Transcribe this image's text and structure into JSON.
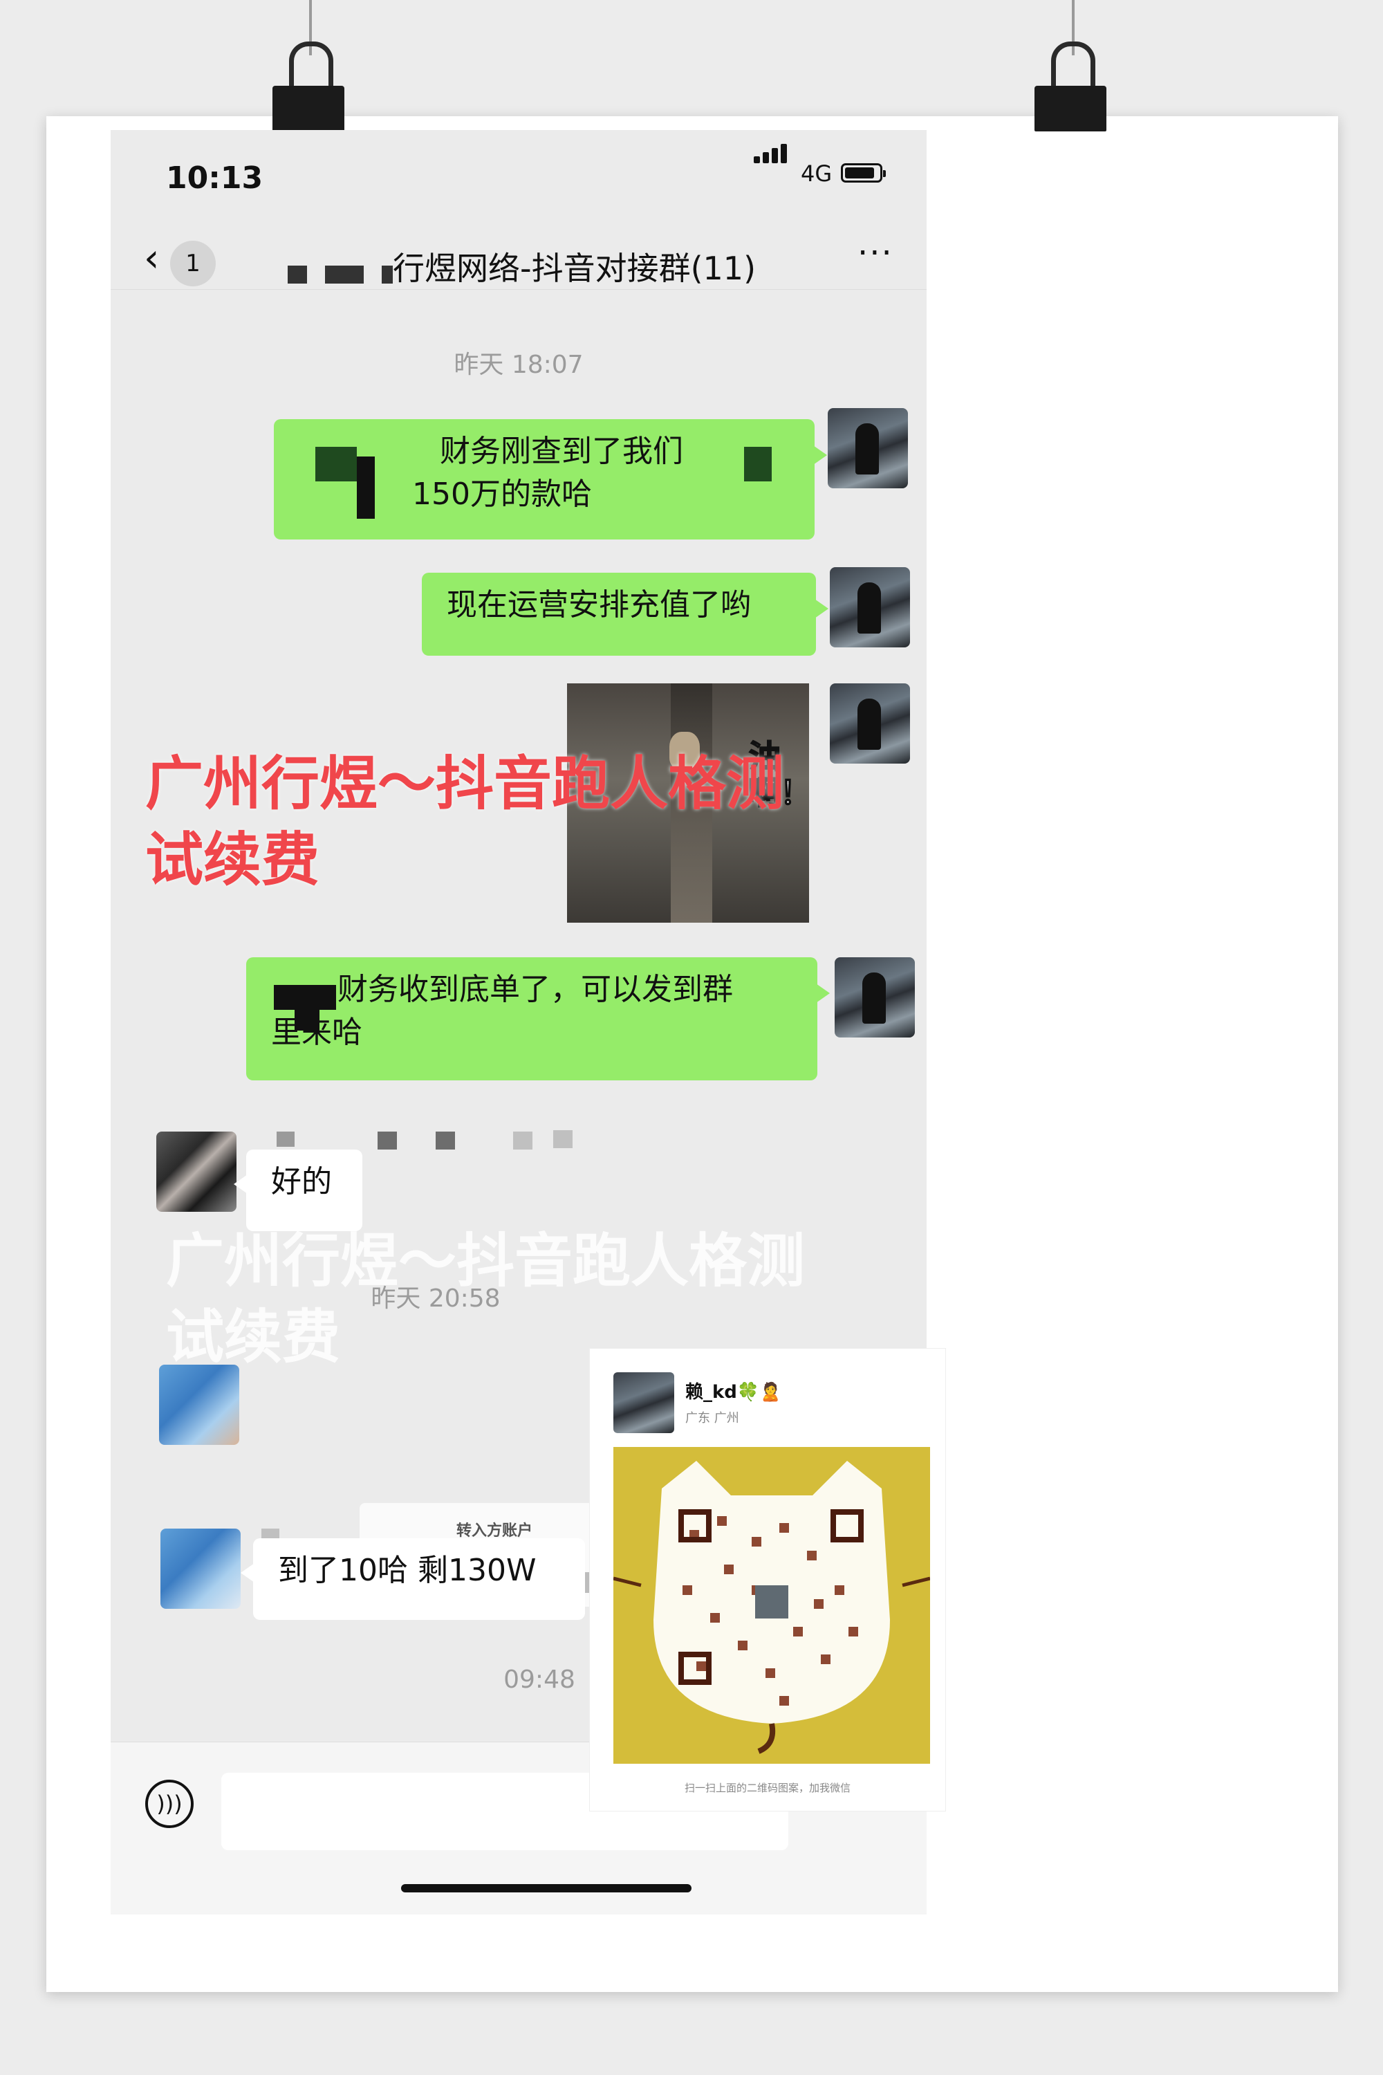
{
  "status_bar": {
    "time": "10:13",
    "network": "4G"
  },
  "nav": {
    "back_count": "1",
    "title": "行煜网络-抖音对接群(11)",
    "more": "···"
  },
  "timestamps": {
    "first": "昨天 18:07",
    "second": "昨天 20:58",
    "third": "09:48"
  },
  "messages": {
    "m1_line1": "财务刚查到了我们",
    "m1_line2": "150万的款哈",
    "m2": "现在运营安排充值了哟",
    "video_caption": "油啊！",
    "m3_line1": "财务收到底单了，可以发到群",
    "m3_line2": "里来哈",
    "m4": "好的",
    "transfer_label": "转入方账户",
    "m5": "到了10哈 剩130W"
  },
  "watermark": {
    "line1": "广州行煜～抖音跑人格测",
    "line2": "试续费"
  },
  "qr_card": {
    "name": "赖_kd🍀🙎",
    "region": "广东 广州",
    "caption": "扫一扫上面的二维码图案，加我微信"
  },
  "colors": {
    "bubble_green": "#95ec69",
    "watermark_red": "#f0464b",
    "qr_yellow": "#d4bd3a"
  }
}
